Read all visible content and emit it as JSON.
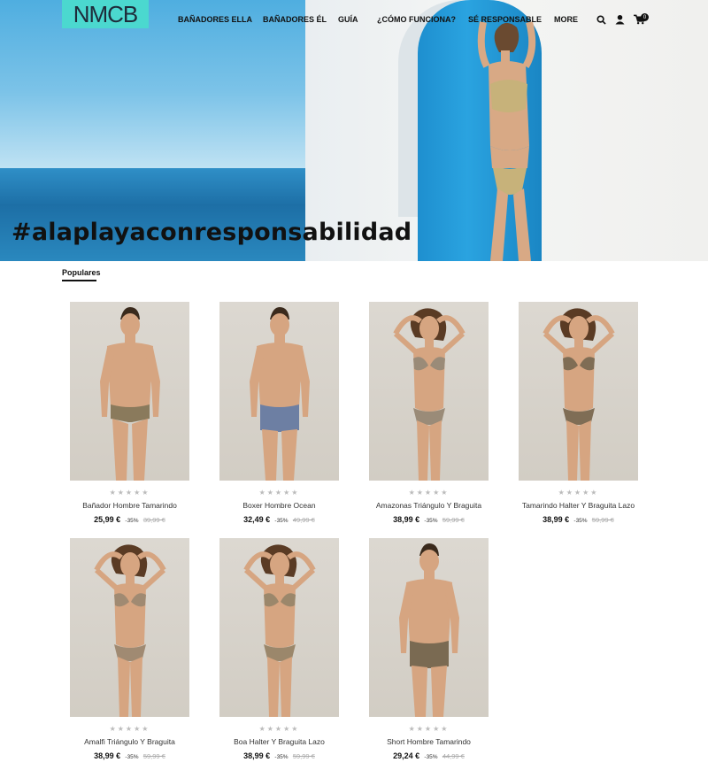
{
  "brand": {
    "logo_text": "NMCB"
  },
  "nav": {
    "items": [
      "BAÑADORES ELLA",
      "BAÑADORES ÉL",
      "GUÍA",
      "¿CÓMO FUNCIONA?",
      "SÉ RESPONSABLE",
      "MORE"
    ],
    "cart_count": "0",
    "icons": [
      "search-icon",
      "user-icon",
      "cart-icon"
    ]
  },
  "hero": {
    "hashtag": "#alaplayaconresponsabilidad"
  },
  "section": {
    "title": "Populares"
  },
  "products": [
    {
      "name": "Bañador Hombre Tamarindo",
      "price": "25,99 €",
      "discount": "-35%",
      "old_price": "39,99 €",
      "stars": "★★★★★",
      "type": "man",
      "suit": "#8a7a5c"
    },
    {
      "name": "Boxer Hombre Ocean",
      "price": "32,49 €",
      "discount": "-35%",
      "old_price": "49,99 €",
      "stars": "★★★★★",
      "type": "man-boxer",
      "suit": "#6d7fa3"
    },
    {
      "name": "Amazonas Triángulo Y Braguita",
      "price": "38,99 €",
      "discount": "-35%",
      "old_price": "59,99 €",
      "stars": "★★★★★",
      "type": "woman",
      "suit": "#9a8b78"
    },
    {
      "name": "Tamarindo Halter Y Braguita Lazo",
      "price": "38,99 €",
      "discount": "-35%",
      "old_price": "59,99 €",
      "stars": "★★★★★",
      "type": "woman",
      "suit": "#7f6d55"
    },
    {
      "name": "Amalfi Triángulo Y Braguita",
      "price": "38,99 €",
      "discount": "-35%",
      "old_price": "59,99 €",
      "stars": "★★★★★",
      "type": "woman",
      "suit": "#a08a72"
    },
    {
      "name": "Boa Halter Y Braguita Lazo",
      "price": "38,99 €",
      "discount": "-35%",
      "old_price": "59,99 €",
      "stars": "★★★★★",
      "type": "woman",
      "suit": "#9b876b"
    },
    {
      "name": "Short Hombre Tamarindo",
      "price": "29,24 €",
      "discount": "-35%",
      "old_price": "44,99 €",
      "stars": "★★★★★",
      "type": "man-boxer",
      "suit": "#7a6a52"
    }
  ]
}
